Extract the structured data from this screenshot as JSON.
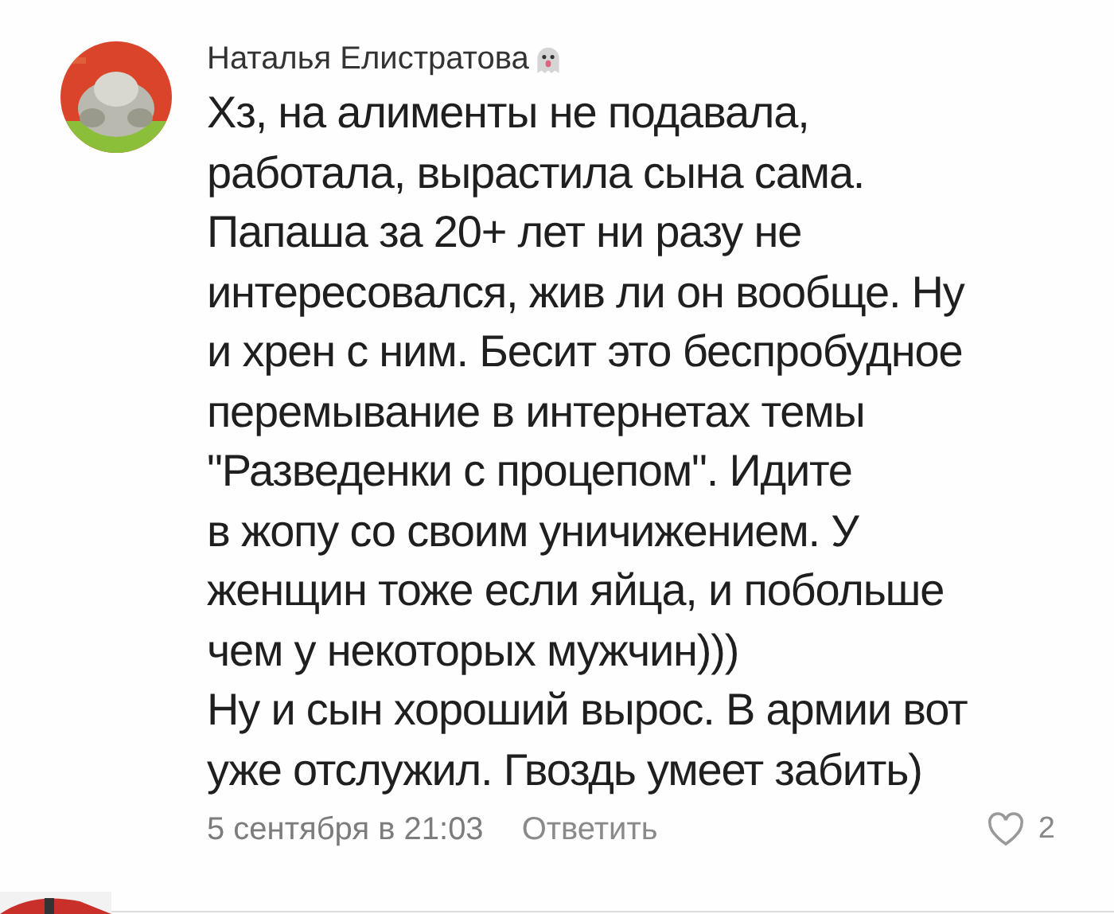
{
  "comment": {
    "author": "Наталья Елистратова",
    "lines": [
      "Хз, на алименты не подавала,",
      "работала, вырастила сына сама.",
      "Папаша за 20+ лет ни разу не",
      "интересовался, жив ли он вообще. Ну",
      "и хрен с ним. Бесит это беспробудное",
      "перемывание в интернетах темы",
      "\"Разведенки с процепом\". Идите",
      "в жопу со своим уничижением. У",
      "женщин тоже если яйца, и побольше",
      "чем у некоторых мужчин)))",
      "Ну и сын хороший вырос. В армии вот",
      "уже отслужил. Гвоздь умеет забить)"
    ],
    "date": "5 сентября в 21:03",
    "reply": "Ответить",
    "likes": "2",
    "liked": false
  }
}
